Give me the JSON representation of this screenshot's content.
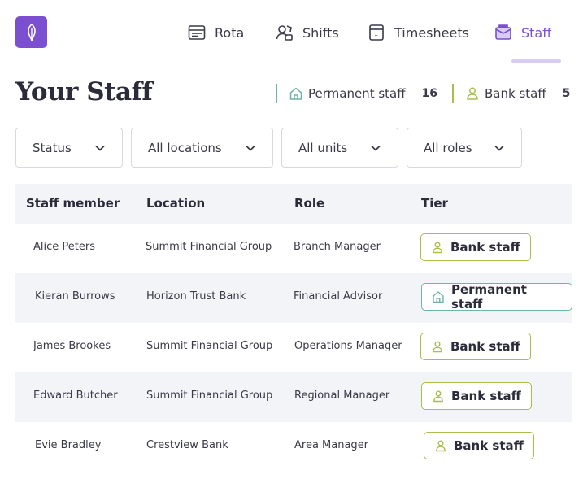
{
  "nav": {
    "items": [
      {
        "label": "Rota",
        "icon": "rota-icon"
      },
      {
        "label": "Shifts",
        "icon": "shifts-icon"
      },
      {
        "label": "Timesheets",
        "icon": "timesheets-icon"
      },
      {
        "label": "Staff",
        "icon": "staff-icon",
        "active": true
      }
    ]
  },
  "page": {
    "title": "Your Staff",
    "counts": {
      "permanent_label": "Permanent staff",
      "permanent_value": "16",
      "bank_label": "Bank staff",
      "bank_value": "5"
    }
  },
  "filters": {
    "status": "Status",
    "locations": "All locations",
    "units": "All units",
    "roles": "All roles"
  },
  "table": {
    "columns": [
      "Staff member",
      "Location",
      "Role",
      "Tier"
    ],
    "rows": [
      {
        "name": "Alice Peters",
        "location": "Summit Financial Group",
        "role": "Branch Manager",
        "tier": "Bank staff"
      },
      {
        "name": "Kieran Burrows",
        "location": "Horizon Trust Bank",
        "role": "Financial Advisor",
        "tier": "Permanent staff"
      },
      {
        "name": "James Brookes",
        "location": "Summit Financial Group",
        "role": "Operations Manager",
        "tier": "Bank staff"
      },
      {
        "name": "Edward Butcher",
        "location": "Summit Financial Group",
        "role": "Regional Manager",
        "tier": "Bank staff"
      },
      {
        "name": "Evie Bradley",
        "location": "Crestview Bank",
        "role": "Area Manager",
        "tier": "Bank staff"
      }
    ]
  },
  "colors": {
    "brand": "#7b4fcf",
    "permanent": "#6fb3ac",
    "bank": "#a7bf4a",
    "row_alt": "#f3f4f8"
  }
}
